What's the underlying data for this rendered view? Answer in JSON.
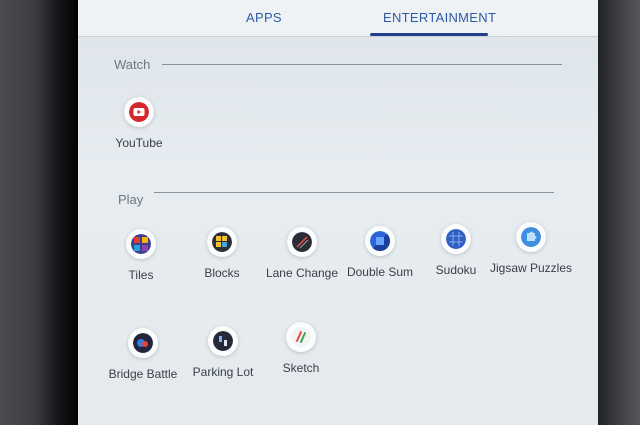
{
  "tabs": [
    {
      "label": "APPS",
      "active": false
    },
    {
      "label": "ENTERTAINMENT",
      "active": true
    }
  ],
  "sections": {
    "watch": {
      "title": "Watch",
      "apps": [
        {
          "label": "YouTube",
          "icon": "youtube-icon"
        }
      ]
    },
    "play": {
      "title": "Play",
      "apps": [
        {
          "label": "Tiles",
          "icon": "tiles-icon"
        },
        {
          "label": "Blocks",
          "icon": "blocks-icon"
        },
        {
          "label": "Lane Change",
          "icon": "lane-change-icon"
        },
        {
          "label": "Double Sum",
          "icon": "double-sum-icon"
        },
        {
          "label": "Sudoku",
          "icon": "sudoku-icon"
        },
        {
          "label": "Jigsaw Puzzles",
          "icon": "jigsaw-puzzles-icon"
        },
        {
          "label": "Bridge Battle",
          "icon": "bridge-battle-icon"
        },
        {
          "label": "Parking Lot",
          "icon": "parking-lot-icon"
        },
        {
          "label": "Sketch",
          "icon": "sketch-icon"
        }
      ]
    }
  },
  "colors": {
    "accent": "#213f91",
    "tab_text": "#2f5aa6",
    "youtube": "#d6282a"
  }
}
